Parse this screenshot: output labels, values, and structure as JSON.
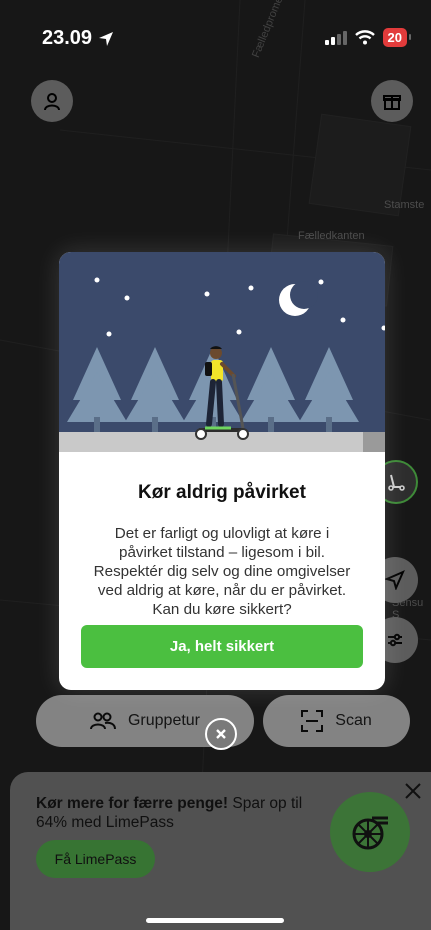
{
  "status": {
    "time": "23.09",
    "battery": "20"
  },
  "map": {
    "street1": "Fælledpromenaden",
    "place1": "Fælledkanten",
    "place2": "Stamste",
    "place3": "Sensu S"
  },
  "modal": {
    "title": "Kør aldrig påvirket",
    "body_lines": [
      "Det er farligt og ulovligt at køre i",
      "påvirket tilstand – ligesom i bil.",
      "Respektér dig selv og dine omgivelser",
      "ved aldrig at køre, når du er påvirket.",
      "Kan du køre sikkert?"
    ],
    "confirm_label": "Ja, helt sikkert"
  },
  "actions": {
    "group_label": "Gruppetur",
    "scan_label": "Scan"
  },
  "promo": {
    "bold": "Kør mere for færre penge!",
    "text": " Spar op til 64% med LimePass",
    "cta": "Få LimePass"
  },
  "colors": {
    "accent": "#4bbf40",
    "night_sky": "#3b4a6b",
    "tree": "#7d96b0",
    "rider_top": "#f2e52a",
    "battery_low": "#e23b3b"
  },
  "icons": [
    "location-arrow-icon",
    "signal-icon",
    "wifi-icon",
    "profile-icon",
    "gift-icon",
    "scooter-icon",
    "navigate-icon",
    "filter-icon",
    "group-icon",
    "scan-icon",
    "close-icon",
    "wheel-icon"
  ]
}
